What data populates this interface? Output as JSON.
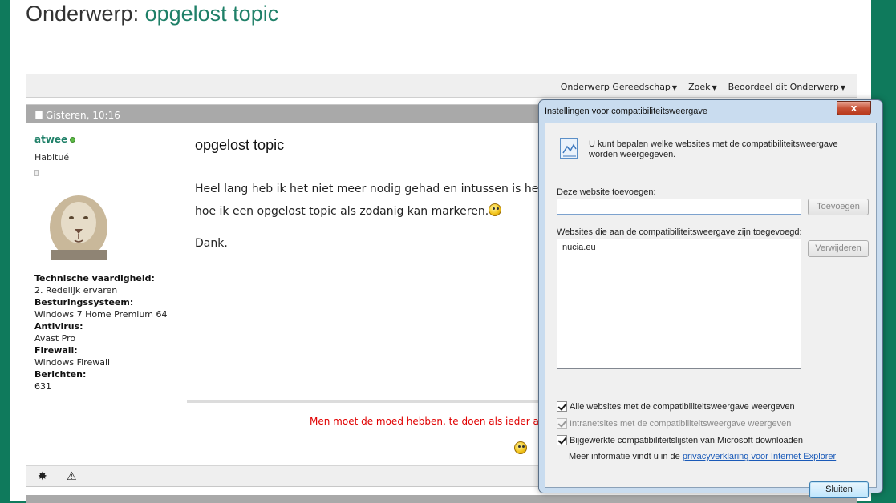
{
  "page": {
    "title_prefix": "Onderwerp:",
    "title_topic": "opgelost topic"
  },
  "toolbar": {
    "tools": [
      "Onderwerp Gereedschap",
      "Zoek",
      "Beoordeel dit Onderwerp"
    ]
  },
  "post": {
    "timestamp": "Gisteren, 10:16",
    "username": "atwee",
    "user_title": "Habitué",
    "fields": [
      {
        "label": "Technische vaardigheid:",
        "value": "2. Redelijk ervaren"
      },
      {
        "label": "Besturingssysteem:",
        "value": "Windows 7 Home Premium 64"
      },
      {
        "label": "Antivirus:",
        "value": "Avast Pro"
      },
      {
        "label": "Firewall:",
        "value": "Windows Firewall"
      },
      {
        "label": "Berichten:",
        "value": "631"
      }
    ],
    "title": "opgelost topic",
    "line1": "Heel lang heb ik het niet meer nodig gehad en intussen is he",
    "line2": "hoe ik een opgelost topic als zodanig kan markeren.",
    "thanks": "Dank.",
    "signature": "Men moet de moed hebben, te doen als ieder and"
  },
  "dialog": {
    "title": "Instellingen voor compatibiliteitsweergave",
    "close_label": "x",
    "info_text": "U kunt bepalen welke websites met de compatibiliteitsweergave worden weergegeven.",
    "add_label": "Deze website toevoegen:",
    "add_value": "",
    "add_button": "Toevoegen",
    "list_label": "Websites die aan de compatibiliteitsweergave zijn toegevoegd:",
    "sites": [
      "nucia.eu"
    ],
    "remove_button": "Verwijderen",
    "checkboxes": [
      {
        "label": "Alle websites met de compatibiliteitsweergave weergeven",
        "checked": true,
        "disabled": false
      },
      {
        "label": "Intranetsites met de compatibiliteitsweergave weergeven",
        "checked": true,
        "disabled": true
      },
      {
        "label": "Bijgewerkte compatibiliteitslijsten van Microsoft downloaden",
        "checked": true,
        "disabled": false
      }
    ],
    "more_info_prefix": "Meer informatie vindt u in de",
    "more_info_link": "privacyverklaring voor Internet Explorer",
    "close_button": "Sluiten"
  },
  "colors": {
    "frame_green": "#0f7a5c",
    "accent_green": "#1f8068",
    "signature_red": "#e00000",
    "link_blue": "#1a5ab8"
  }
}
